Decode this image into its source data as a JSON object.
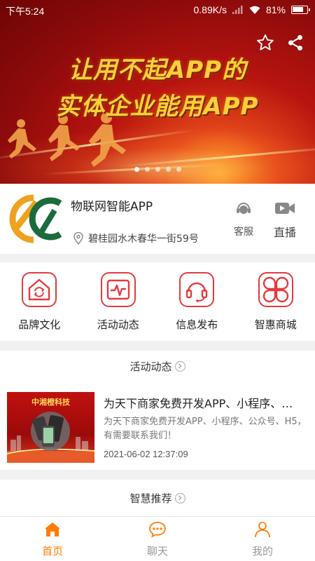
{
  "status_bar": {
    "time": "下午5:24",
    "net_speed": "0.89K/s",
    "battery": "81%",
    "battery_level": 0.81
  },
  "banner": {
    "line1": "让用不起APP的",
    "line2": "实体企业能用APP",
    "slide_count": 5,
    "active_slide": 0
  },
  "store": {
    "name": "物联网智能APP",
    "address": "碧桂园水木春华一街59号",
    "service_label": "客服",
    "live_label": "直播"
  },
  "categories": [
    {
      "label": "品牌文化",
      "icon": "house-refresh-icon"
    },
    {
      "label": "活动动态",
      "icon": "pulse-chart-icon"
    },
    {
      "label": "信息发布",
      "icon": "headset-icon"
    },
    {
      "label": "智惠商城",
      "icon": "four-petal-icon"
    }
  ],
  "activity_section": {
    "title": "活动动态"
  },
  "article": {
    "thumb_caption": "中湘橙科技",
    "title": "为天下商家免费开发APP、小程序、…",
    "desc": "为天下商家免费开发APP、小程序、公众号、H5，有需要联系我们！",
    "time": "2021-06-02 12:37:09"
  },
  "recommend_section": {
    "title": "智慧推荐"
  },
  "tabs": [
    {
      "label": "首页",
      "icon": "home-icon",
      "active": true
    },
    {
      "label": "聊天",
      "icon": "chat-icon",
      "active": false
    },
    {
      "label": "我的",
      "icon": "user-icon",
      "active": false
    }
  ],
  "colors": {
    "accent": "#ff7d00",
    "brand_red": "#e43a3f",
    "banner_text": "#ffcf3a",
    "logo_green": "#1b6b3d",
    "logo_orange": "#f0a21e"
  }
}
